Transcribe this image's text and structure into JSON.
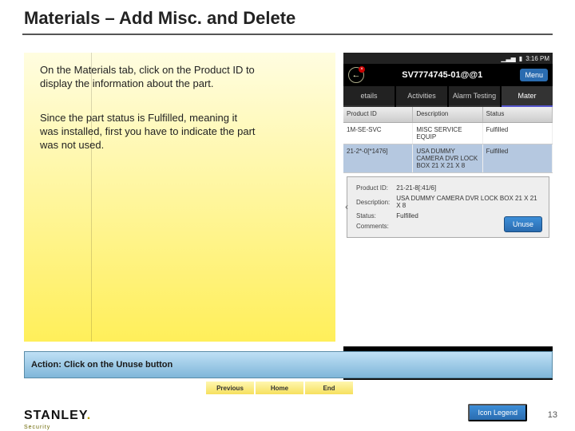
{
  "title": "Materials – Add Misc. and Delete",
  "paragraphs": {
    "p1": "On the Materials tab, click on the Product ID to display the information about the part.",
    "p2": "Since the part status is Fulfilled, meaning it was installed, first you have to indicate the part was not used."
  },
  "action": "Action: Click on the Unuse button",
  "nav": {
    "prev": "Previous",
    "home": "Home",
    "end": "End"
  },
  "brand": {
    "name": "STANLEY",
    "sub": "Security"
  },
  "legend": "Icon Legend",
  "page": "13",
  "phone": {
    "status_time": "3:16 PM",
    "header_title": "SV7774745-01@@1",
    "menu": "Menu",
    "tabs": {
      "t1": "etails",
      "t2": "Activities",
      "t3": "Alarm Testing",
      "t4": "Mater"
    },
    "thead": {
      "c1": "Product ID",
      "c2": "Description",
      "c3": "Status"
    },
    "rows": {
      "r1": {
        "c1": "1M-SE-SVC",
        "c2": "MISC SERVICE EQUIP",
        "c3": "Fulfilled"
      },
      "r2": {
        "c1": "21-2*-0[*1476]",
        "c2": "USA DUMMY CAMERA DVR LOCK BOX 21 X 21 X 8",
        "c3": "Fulfilled"
      }
    },
    "detail": {
      "product_lbl": "Product ID:",
      "product": "21-21-8[:41/6]",
      "desc_lbl": "Description:",
      "desc": "USA DUMMY CAMERA DVR LOCK BOX 21 X 21 X 8",
      "status_lbl": "Status:",
      "status": "Fulfilled",
      "comments_lbl": "Comments:"
    },
    "unuse": "Unuse"
  }
}
